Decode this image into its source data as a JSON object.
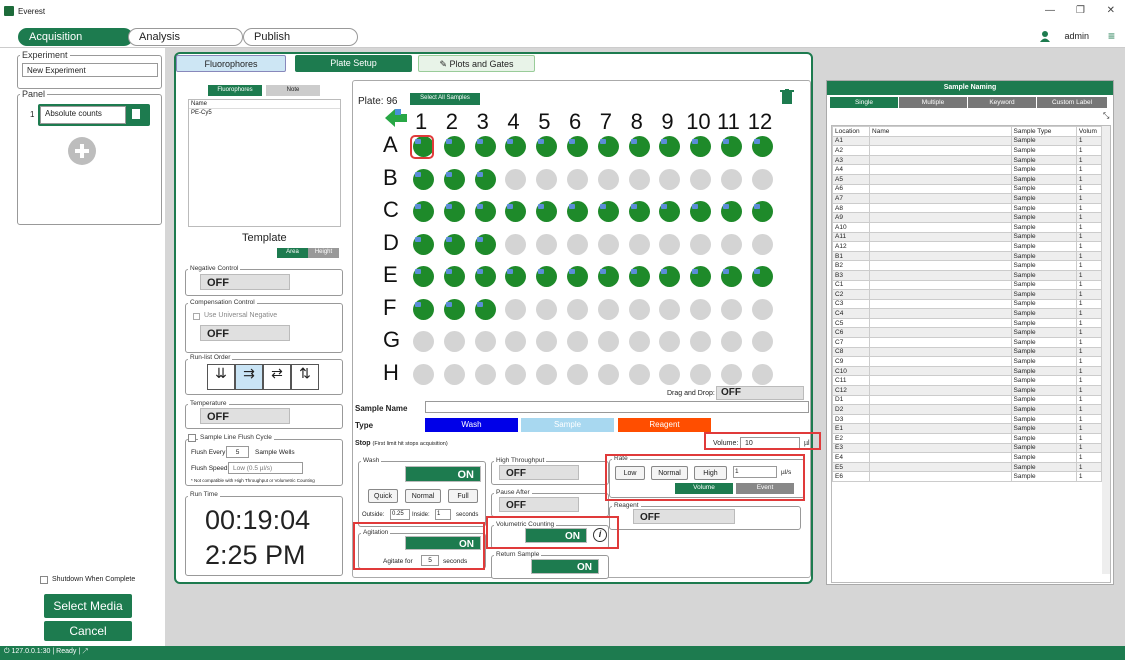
{
  "window": {
    "title": "Everest",
    "admin": "admin"
  },
  "tabs": [
    {
      "label": "Acquisition"
    },
    {
      "label": "Analysis"
    },
    {
      "label": "Publish"
    }
  ],
  "left": {
    "experiment_legend": "Experiment",
    "experiment_value": "New Experiment",
    "panel_legend": "Panel",
    "panel_index": "1",
    "panel_name": "Absolute counts",
    "shutdown_label": "Shutdown When Complete",
    "select_media": "Select Media",
    "cancel": "Cancel"
  },
  "status": {
    "address": "127.0.0.1:30",
    "state": "Ready"
  },
  "subtabs": {
    "fluorophores": "Fluorophores",
    "plate_setup": "Plate Setup",
    "plots": "Plots and Gates"
  },
  "fluor": {
    "tab1": "Fluorophores",
    "tab2": "Note",
    "col_name": "Name",
    "item": "PE-Cy5",
    "template": "Template",
    "area": "Area",
    "height": "Height"
  },
  "controls": {
    "neg_legend": "Negative Control",
    "neg_value": "OFF",
    "comp_legend": "Compensation Control",
    "comp_check": "Use Universal Negative",
    "comp_value": "OFF",
    "runlist_legend": "Run-list Order",
    "temp_legend": "Temperature",
    "temp_value": "OFF",
    "flush_legend": "Sample Line Flush Cycle",
    "flush_every": "Flush Every",
    "flush_n": "5",
    "flush_unit": "Sample Wells",
    "flush_speed": "Flush Speed",
    "flush_speed_val": "Low",
    "flush_speed_rate": "(0.5 µl/s)",
    "flush_note": "* Not compatible with High Throughput or Volumetric Counting",
    "runtime_legend": "Run Time",
    "runtime": "00:19:04",
    "clock": "2:25 PM"
  },
  "plate": {
    "label": "Plate: 96",
    "select_all": "Select All Samples",
    "cols": [
      "1",
      "2",
      "3",
      "4",
      "5",
      "6",
      "7",
      "8",
      "9",
      "10",
      "11",
      "12"
    ],
    "rows": [
      "A",
      "B",
      "C",
      "D",
      "E",
      "F",
      "G",
      "H"
    ],
    "filled": [
      12,
      3,
      12,
      3,
      12,
      3,
      0,
      0
    ],
    "drag_drop": "Drag and Drop:",
    "drag_drop_value": "OFF",
    "sample_name": "Sample Name",
    "type": "Type",
    "wash": "Wash",
    "sample": "Sample",
    "reagent": "Reagent",
    "stop": "Stop",
    "stop_note": "(First limit hit stops acquisition)",
    "volume_label": "Volume:",
    "volume": "10",
    "volume_unit": "µl"
  },
  "wash": {
    "legend": "Wash",
    "value": "ON",
    "quick": "Quick",
    "normal": "Normal",
    "full": "Full",
    "outside": "Outside:",
    "outside_v": "0.25",
    "inside": "Inside:",
    "inside_v": "1",
    "seconds": "seconds"
  },
  "agitation": {
    "legend": "Agitation",
    "value": "ON",
    "label": "Agitate for",
    "n": "5",
    "unit": "seconds"
  },
  "high_throughput": {
    "legend": "High Throughput",
    "value": "OFF"
  },
  "pause_after": {
    "legend": "Pause After",
    "value": "OFF"
  },
  "volumetric": {
    "legend": "Volumetric Counting",
    "value": "ON"
  },
  "return_sample": {
    "legend": "Return Sample",
    "value": "ON"
  },
  "rate": {
    "legend": "Rate",
    "low": "Low",
    "normal": "Normal",
    "high": "High",
    "value": "1",
    "unit": "µl/s",
    "volume": "Volume",
    "event": "Event"
  },
  "reagent": {
    "legend": "Reagent",
    "value": "OFF"
  },
  "naming": {
    "title": "Sample Naming",
    "tabs": [
      "Single",
      "Multiple",
      "Keyword",
      "Custom Label"
    ],
    "headers": [
      "Location",
      "Name",
      "Sample Type",
      "Volum"
    ],
    "rows": [
      [
        "A1",
        "",
        "Sample",
        "1"
      ],
      [
        "A2",
        "",
        "Sample",
        "1"
      ],
      [
        "A3",
        "",
        "Sample",
        "1"
      ],
      [
        "A4",
        "",
        "Sample",
        "1"
      ],
      [
        "A5",
        "",
        "Sample",
        "1"
      ],
      [
        "A6",
        "",
        "Sample",
        "1"
      ],
      [
        "A7",
        "",
        "Sample",
        "1"
      ],
      [
        "A8",
        "",
        "Sample",
        "1"
      ],
      [
        "A9",
        "",
        "Sample",
        "1"
      ],
      [
        "A10",
        "",
        "Sample",
        "1"
      ],
      [
        "A11",
        "",
        "Sample",
        "1"
      ],
      [
        "A12",
        "",
        "Sample",
        "1"
      ],
      [
        "B1",
        "",
        "Sample",
        "1"
      ],
      [
        "B2",
        "",
        "Sample",
        "1"
      ],
      [
        "B3",
        "",
        "Sample",
        "1"
      ],
      [
        "C1",
        "",
        "Sample",
        "1"
      ],
      [
        "C2",
        "",
        "Sample",
        "1"
      ],
      [
        "C3",
        "",
        "Sample",
        "1"
      ],
      [
        "C4",
        "",
        "Sample",
        "1"
      ],
      [
        "C5",
        "",
        "Sample",
        "1"
      ],
      [
        "C6",
        "",
        "Sample",
        "1"
      ],
      [
        "C7",
        "",
        "Sample",
        "1"
      ],
      [
        "C8",
        "",
        "Sample",
        "1"
      ],
      [
        "C9",
        "",
        "Sample",
        "1"
      ],
      [
        "C10",
        "",
        "Sample",
        "1"
      ],
      [
        "C11",
        "",
        "Sample",
        "1"
      ],
      [
        "C12",
        "",
        "Sample",
        "1"
      ],
      [
        "D1",
        "",
        "Sample",
        "1"
      ],
      [
        "D2",
        "",
        "Sample",
        "1"
      ],
      [
        "D3",
        "",
        "Sample",
        "1"
      ],
      [
        "E1",
        "",
        "Sample",
        "1"
      ],
      [
        "E2",
        "",
        "Sample",
        "1"
      ],
      [
        "E3",
        "",
        "Sample",
        "1"
      ],
      [
        "E4",
        "",
        "Sample",
        "1"
      ],
      [
        "E5",
        "",
        "Sample",
        "1"
      ],
      [
        "E6",
        "",
        "Sample",
        "1"
      ]
    ]
  }
}
